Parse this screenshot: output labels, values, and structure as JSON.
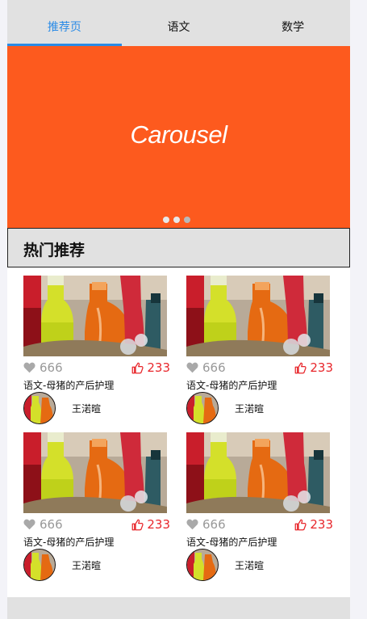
{
  "tabs": [
    {
      "label": "推荐页",
      "active": true
    },
    {
      "label": "语文",
      "active": false
    },
    {
      "label": "数学",
      "active": false
    }
  ],
  "carousel": {
    "label": "Carousel",
    "background": "#fd5a1e",
    "dots": 3,
    "active_dot": 1
  },
  "section": {
    "title": "热门推荐"
  },
  "cards": [
    {
      "views": "666",
      "likes": "233",
      "title": "语文-母猪的产后护理",
      "author": "王渃暄"
    },
    {
      "views": "666",
      "likes": "233",
      "title": "语文-母猪的产后护理",
      "author": "王渃暄"
    },
    {
      "views": "666",
      "likes": "233",
      "title": "语文-母猪的产后护理",
      "author": "王渃暄"
    },
    {
      "views": "666",
      "likes": "233",
      "title": "语文-母猪的产后护理",
      "author": "王渃暄"
    }
  ],
  "colors": {
    "accent": "#2a8be6",
    "like": "#e8272c",
    "muted": "#999999"
  },
  "icons": {
    "views": "heart-icon",
    "likes": "thumbs-up-icon"
  }
}
